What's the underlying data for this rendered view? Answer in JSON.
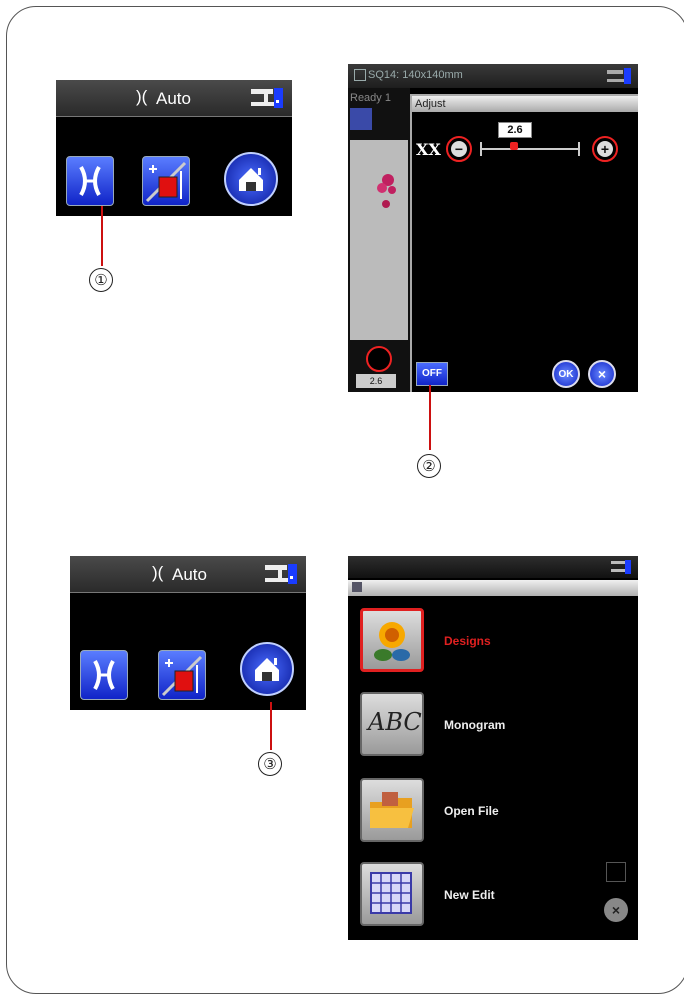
{
  "mini_screen_1": {
    "status_label": "Auto",
    "icons": [
      "needle-guide-icon",
      "move-frame-icon",
      "home-icon"
    ],
    "callout": "①"
  },
  "adjust_screen": {
    "status_text": "SQ14: 140x140mm",
    "ready_text": "Ready 1",
    "panel_title": "Adjust",
    "value_text": "2.6",
    "value": 2.6,
    "off_button": "OFF",
    "ok_button": "OK",
    "close_button": "×",
    "minus": "−",
    "plus": "+",
    "bottom_text": "2.6",
    "callout": "②"
  },
  "mini_screen_2": {
    "status_label": "Auto",
    "icons": [
      "needle-guide-icon",
      "move-frame-icon",
      "home-icon"
    ],
    "callout": "③"
  },
  "home_screen": {
    "items": [
      {
        "label": "Designs",
        "icon": "flower-icon",
        "selected": true
      },
      {
        "label": "Monogram",
        "icon": "abc-icon",
        "selected": false
      },
      {
        "label": "Open File",
        "icon": "folder-icon",
        "selected": false
      },
      {
        "label": "New Edit",
        "icon": "grid-icon",
        "selected": false
      }
    ],
    "close_button": "×"
  },
  "colors": {
    "accent_blue": "#1024c8",
    "callout_red": "#cc1010",
    "selected_red": "#e02020"
  }
}
